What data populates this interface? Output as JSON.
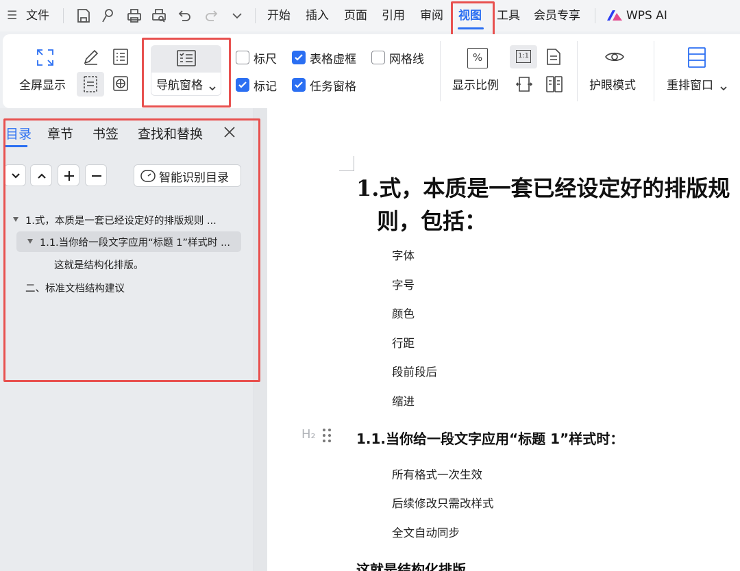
{
  "menubar": {
    "menu_glyph": "☰",
    "file_label": "文件",
    "items": [
      "开始",
      "插入",
      "页面",
      "引用",
      "审阅",
      "视图",
      "工具",
      "会员专享"
    ],
    "wps_ai_label": "WPS AI",
    "active_tab": "视图"
  },
  "ribbon": {
    "fullscreen_label": "全屏显示",
    "nav_pane_label": "导航窗格",
    "ruler_label": "标尺",
    "table_gridlines_label": "表格虚框",
    "gridlines_label": "网格线",
    "marks_label": "标记",
    "task_pane_label": "任务窗格",
    "zoom_label": "显示比例",
    "zoom_icon_text": "%",
    "one_to_one_text": "1:1",
    "eye_mode_label": "护眼模式",
    "arrange_label": "重排窗口",
    "checks": {
      "ruler": false,
      "table_gridlines": true,
      "gridlines": false,
      "marks": true,
      "task_pane": true
    }
  },
  "navpane": {
    "tabs": [
      "目录",
      "章节",
      "书签",
      "查找和替换"
    ],
    "active_tab": "目录",
    "smart_toc_label": "智能识别目录",
    "toc": [
      {
        "text": "1.式，本质是一套已经设定好的排版规则 ..."
      },
      {
        "text": "1.1.当你给一段文字应用“标题  1”样式时 ..."
      },
      {
        "text": "这就是结构化排版。"
      },
      {
        "text": "二、标准文档结构建议"
      }
    ]
  },
  "document": {
    "h1_line1": "1.式，本质是一套已经设定好的排版规",
    "h1_line2": "则，包括：",
    "list1": [
      "字体",
      "字号",
      "颜色",
      "行距",
      "段前段后",
      "缩进"
    ],
    "h2_marker": "H₂",
    "h2": "1.1.当你给一段文字应用“标题  1”样式时：",
    "list2": [
      "所有格式一次生效",
      "后续修改只需改样式",
      "全文自动同步"
    ],
    "h3": "这就是结构化排版"
  },
  "colors": {
    "accent": "#2b6ff2",
    "highlight_red": "#e8514f",
    "pane_bg": "#e9ebee",
    "doc_bg": "#ffffff"
  }
}
